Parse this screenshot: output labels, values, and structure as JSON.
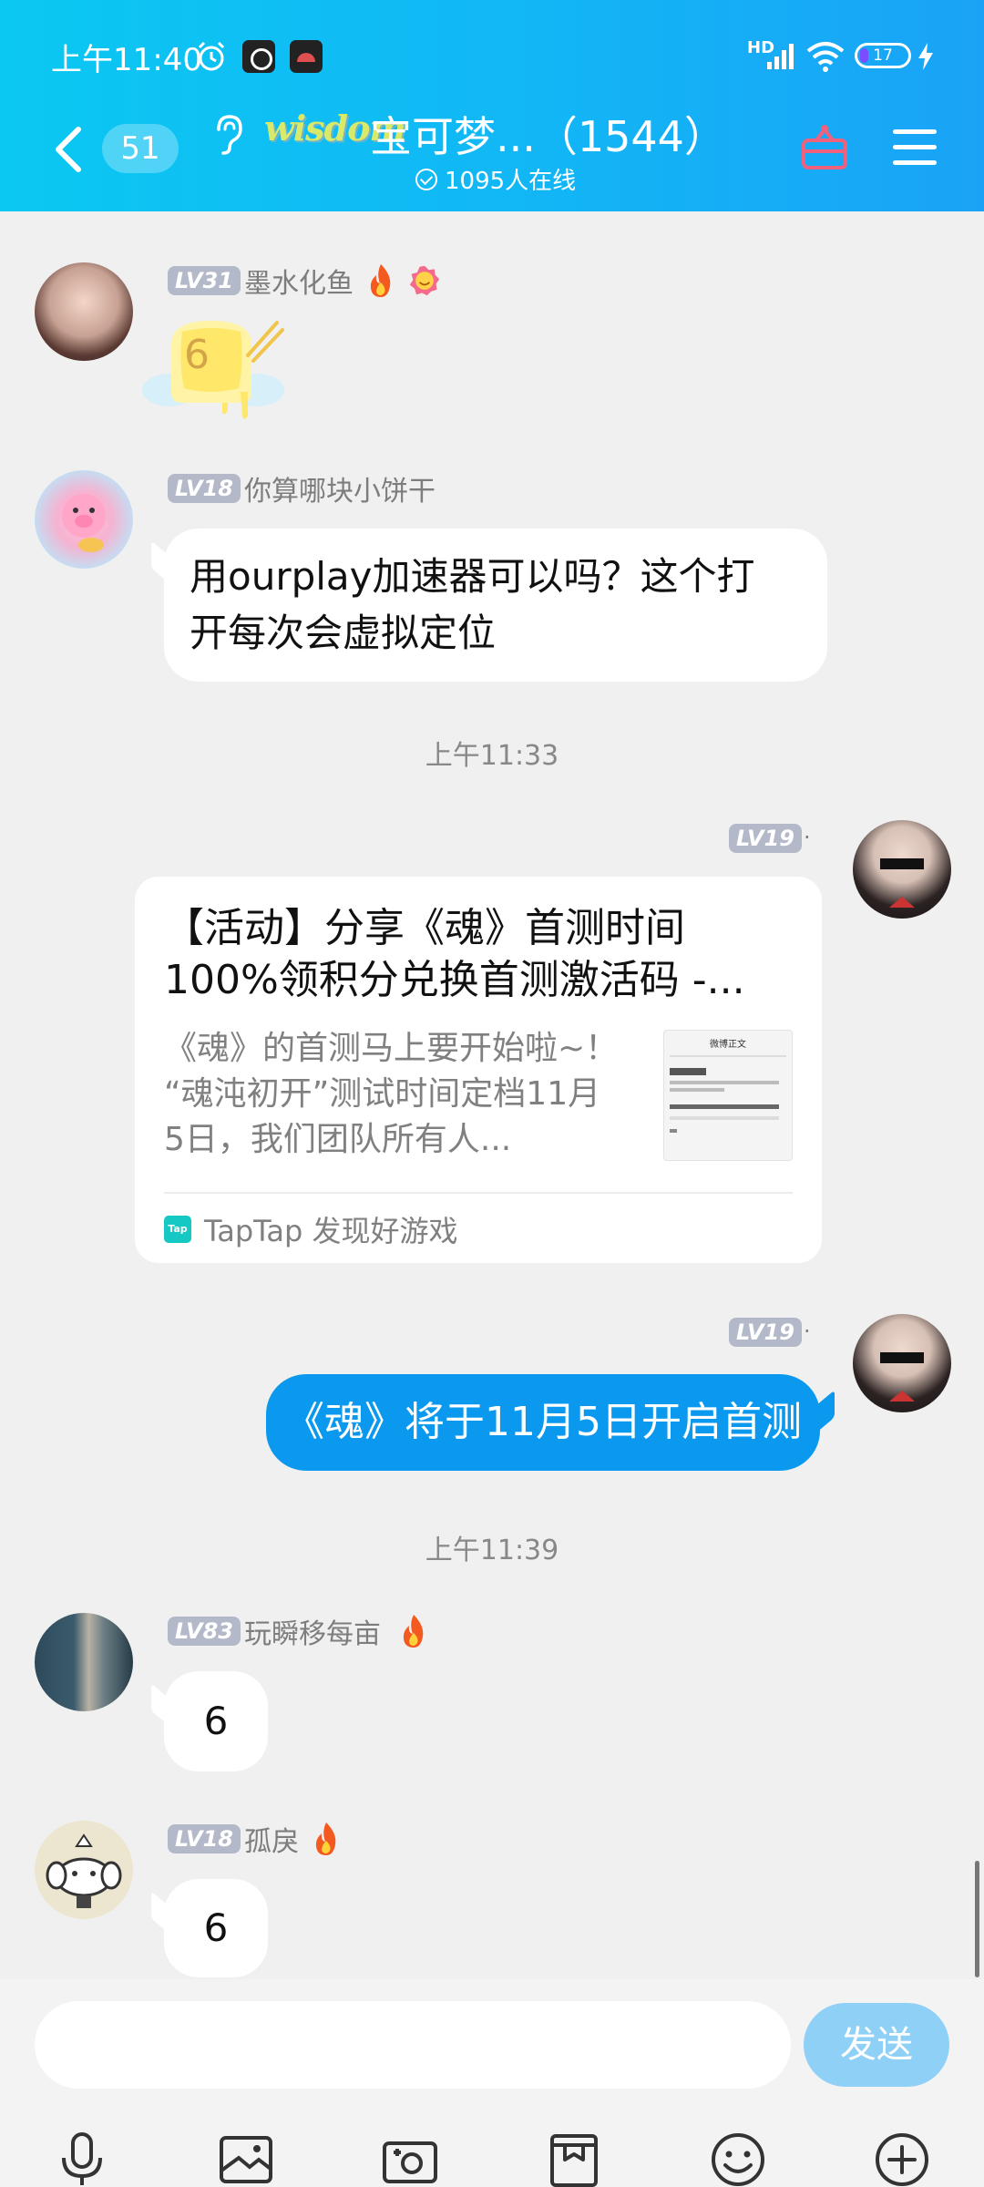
{
  "status_bar": {
    "time": "上午11:40",
    "network_label": "HD",
    "battery": "17",
    "battery_level": 0.17
  },
  "header": {
    "back_count": "51",
    "logo_text": "wisdom",
    "group_title": "宝可梦...（1544）",
    "online": "1095人在线"
  },
  "messages": [
    {
      "level": "LV31",
      "sender": "墨水化鱼",
      "sticker_number": "6"
    },
    {
      "level": "LV18",
      "sender": "你算哪块小饼干",
      "text_line1": "用ourplay加速器可以吗？这个打",
      "text_line2": "开每次会虚拟定位"
    },
    {
      "time": "上午11:33"
    },
    {
      "level": "LV19",
      "sender": ".",
      "card": {
        "title_line1": "【活动】分享《魂》首测时间",
        "title_line2": "100%领积分兑换首测激活码 -...",
        "desc_line1": "《魂》的首测马上要开始啦~！",
        "desc_line2": "“魂沌初开”测试时间定档11月",
        "desc_line3": "5日，我们团队所有人...",
        "thumb_header": "微博正文",
        "source_icon": "Tap",
        "source": "TapTap 发现好游戏"
      }
    },
    {
      "level": "LV19",
      "sender": ".",
      "text": "《魂》将于11月5日开启首测"
    },
    {
      "time": "上午11:39"
    },
    {
      "level": "LV83",
      "sender": "玩瞬移每亩",
      "text": "6"
    },
    {
      "level": "LV18",
      "sender": "孤戾",
      "text": "6"
    }
  ],
  "input": {
    "placeholder": "",
    "send_label": "发送"
  },
  "colors": {
    "header_gradient_start": "#0bc8f2",
    "header_gradient_end": "#1aa3f6",
    "own_bubble": "#0a99ee",
    "send_button": "#8fd0f7",
    "level_badge": "#b3b9c9"
  },
  "icons": {
    "toolbar": [
      "microphone-icon",
      "image-icon",
      "camera-icon",
      "bookmark-bag-icon",
      "emoji-icon",
      "plus-icon"
    ]
  }
}
